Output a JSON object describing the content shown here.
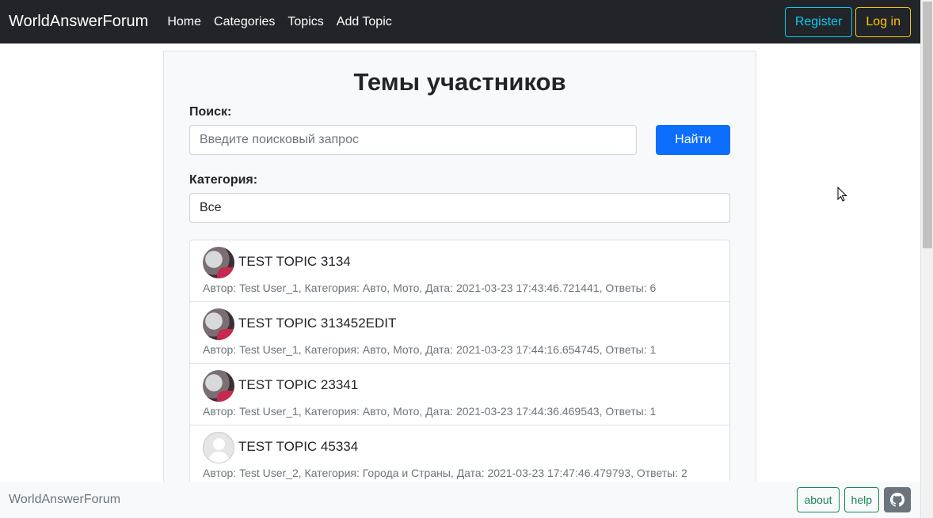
{
  "navbar": {
    "brand": "WorldAnswerForum",
    "links": [
      "Home",
      "Categories",
      "Topics",
      "Add Topic"
    ],
    "register_label": "Register",
    "login_label": "Log in"
  },
  "main": {
    "title": "Темы участников",
    "search_label": "Поиск:",
    "search_placeholder": "Введите поисковый запрос",
    "search_button": "Найти",
    "category_label": "Категория:",
    "category_selected": "Все"
  },
  "topics": [
    {
      "title": "TEST TOPIC 3134",
      "meta": "Автор: Test User_1, Категория: Авто, Мото, Дата: 2021-03-23 17:43:46.721441, Ответы: 6",
      "avatar": "photo"
    },
    {
      "title": "TEST TOPIC 313452EDIT",
      "meta": "Автор: Test User_1, Категория: Авто, Мото, Дата: 2021-03-23 17:44:16.654745, Ответы: 1",
      "avatar": "photo"
    },
    {
      "title": "TEST TOPIC 23341",
      "meta": "Автор: Test User_1, Категория: Авто, Мото, Дата: 2021-03-23 17:44:36.469543, Ответы: 1",
      "avatar": "photo"
    },
    {
      "title": "TEST TOPIC 45334",
      "meta": "Автор: Test User_2, Категория: Города и Страны, Дата: 2021-03-23 17:47:46.479793, Ответы: 2",
      "avatar": "default"
    }
  ],
  "footer": {
    "brand": "WorldAnswerForum",
    "about_label": "about",
    "help_label": "help",
    "github_icon": "github-icon"
  },
  "colors": {
    "navbar_bg": "#212529",
    "primary": "#0d6efd",
    "info": "#0dcaf0",
    "warning": "#ffc107",
    "success": "#198754"
  }
}
